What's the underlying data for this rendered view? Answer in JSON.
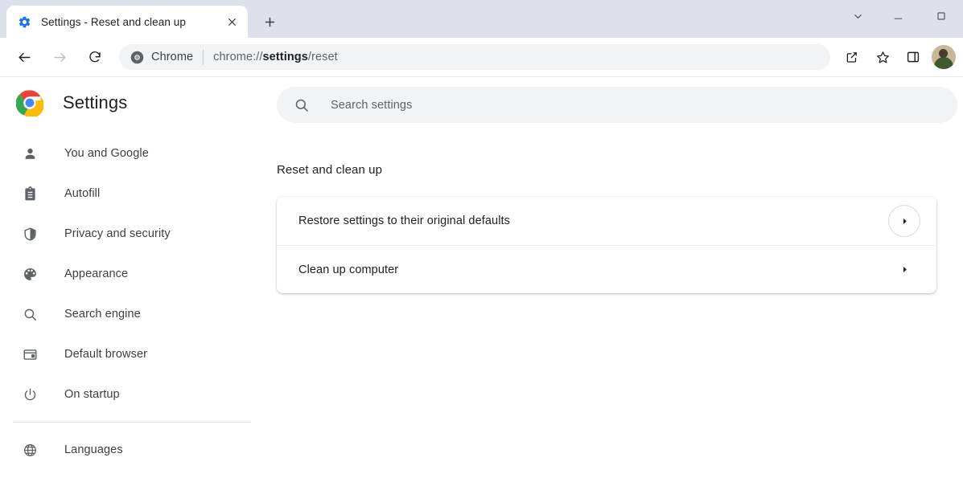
{
  "window": {
    "tab": {
      "favicon": "settings-gear-icon",
      "title": "Settings - Reset and clean up",
      "close_label": "×"
    },
    "new_tab_label": "+",
    "controls": [
      {
        "name": "tab-search-button",
        "glyph": "⌄"
      },
      {
        "name": "minimize-button",
        "glyph": "–"
      },
      {
        "name": "maximize-button",
        "glyph": "□"
      }
    ]
  },
  "toolbar": {
    "back_label": "Back",
    "forward_label": "Forward",
    "reload_label": "Reload",
    "omnibox": {
      "chip_icon": "chrome-logo-icon",
      "chip_label": "Chrome",
      "url_prefix": "chrome://",
      "url_bold": "settings",
      "url_suffix": "/reset",
      "full_url": "chrome://settings/reset"
    },
    "actions": [
      {
        "name": "share-icon",
        "label": "Share"
      },
      {
        "name": "bookmark-star-icon",
        "label": "Bookmark this tab"
      },
      {
        "name": "side-panel-icon",
        "label": "Side panel"
      }
    ],
    "avatar_label": "Profile"
  },
  "sidebar": {
    "logo": "chrome-logo-icon",
    "title": "Settings",
    "items": [
      {
        "icon": "person-icon",
        "label": "You and Google"
      },
      {
        "icon": "clipboard-icon",
        "label": "Autofill"
      },
      {
        "icon": "shield-icon",
        "label": "Privacy and security"
      },
      {
        "icon": "palette-icon",
        "label": "Appearance"
      },
      {
        "icon": "search-icon",
        "label": "Search engine"
      },
      {
        "icon": "browser-window-icon",
        "label": "Default browser"
      },
      {
        "icon": "power-icon",
        "label": "On startup"
      }
    ],
    "items_after_divider": [
      {
        "icon": "globe-icon",
        "label": "Languages"
      }
    ]
  },
  "main": {
    "search": {
      "icon": "search-icon",
      "placeholder": "Search settings",
      "value": ""
    },
    "section_title": "Reset and clean up",
    "rows": [
      {
        "label": "Restore settings to their original defaults",
        "arrow": "chevron-right-icon",
        "focused": true
      },
      {
        "label": "Clean up computer",
        "arrow": "chevron-right-icon",
        "focused": false
      }
    ]
  },
  "colors": {
    "tabstrip_bg": "#dee1ec",
    "omnibox_bg": "#f1f3f4",
    "text_primary": "#202124",
    "text_secondary": "#5f6368",
    "divider": "#e8eaed"
  }
}
